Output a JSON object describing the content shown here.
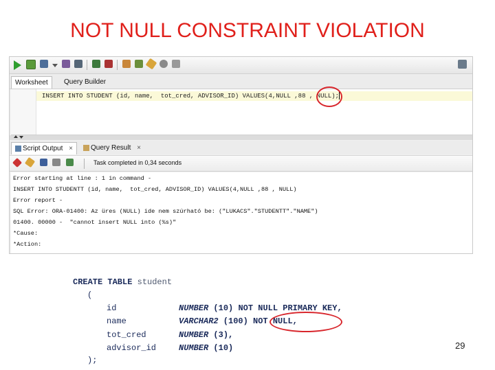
{
  "slide": {
    "title": "NOT NULL CONSTRAINT VIOLATION",
    "page_number": "29"
  },
  "toolbar": {
    "icons": [
      "run-statement-icon",
      "run-script-icon",
      "commit-icon",
      "dropdown-arrow-icon",
      "autotrace-icon",
      "explain-plan-icon",
      "commit-icon",
      "rollback-icon",
      "sql-tuning-icon",
      "format-icon",
      "eraser-icon",
      "history-icon",
      "clear-icon",
      "connection-icon"
    ]
  },
  "worksheet_tabs": [
    {
      "label": "Worksheet",
      "active": true
    },
    {
      "label": "Query Builder",
      "active": false
    }
  ],
  "editor": {
    "code_before": "INSERT INTO STUDENT (id, name,  tot_cred, ADVISOR_ID) VALUES(4,",
    "code_null": "NULL",
    "code_after": " ,88 , NULL);"
  },
  "output_tabs": [
    {
      "label": "Script Output",
      "close": "×"
    },
    {
      "label": "Query Result",
      "close": "×"
    }
  ],
  "output_toolbar": {
    "status": "Task completed in 0,34 seconds"
  },
  "output_lines": [
    "Error starting at line : 1 in command -",
    "INSERT INTO STUDENTT (id, name,  tot_cred, ADVISOR_ID) VALUES(4,NULL ,88 , NULL)",
    "Error report -",
    "SQL Error: ORA-01400: Az üres (NULL) ide nem szúrható be: (\"LUKACS\".\"STUDENTT\".\"NAME\")",
    "01400. 00000 -  \"cannot insert NULL into (%s)\"",
    "*Cause:",
    "*Action:"
  ],
  "create_table": {
    "kw_create": "CREATE TABLE",
    "table_name": " student",
    "open_paren": "(",
    "rows": [
      {
        "col": "id",
        "type": "NUMBER",
        "size": " (10) ",
        "constraint": "NOT NULL PRIMARY KEY,"
      },
      {
        "col": "name",
        "type": "VARCHAR2",
        "size": " (100) ",
        "constraint": "NOT NULL,"
      },
      {
        "col": "tot_cred",
        "type": "NUMBER",
        "size": " (3),",
        "constraint": ""
      },
      {
        "col": "advisor_id",
        "type": "NUMBER",
        "size": " (10)",
        "constraint": ""
      }
    ],
    "close": ");"
  },
  "colors": {
    "title_red": "#e0201b",
    "highlight_ring": "#d8262c",
    "sql_navy": "#1a2a5a"
  }
}
